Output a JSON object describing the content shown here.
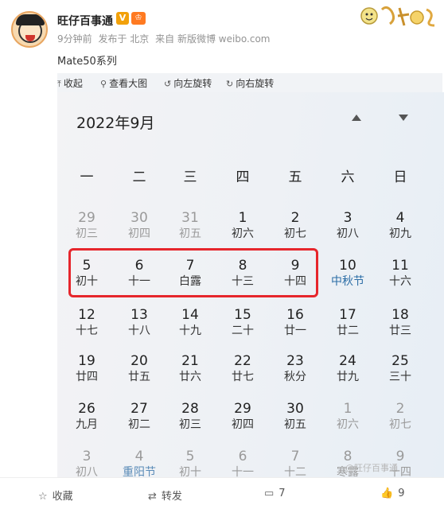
{
  "post": {
    "author": "旺仔百事通",
    "badge_v": "V",
    "badge_vip": "♔",
    "time": "9分钟前",
    "location": "发布于 北京",
    "source": "来自 新版微博 weibo.com",
    "text": "Mate50系列"
  },
  "toolbar": {
    "collapse": "收起",
    "view_large": "查看大图",
    "rotate_left": "向左旋转",
    "rotate_right": "向右旋转"
  },
  "calendar": {
    "title": "2022年9月",
    "weekdays": [
      "一",
      "二",
      "三",
      "四",
      "五",
      "六",
      "日"
    ],
    "rows": [
      [
        [
          "29",
          "初三",
          true,
          false
        ],
        [
          "30",
          "初四",
          true,
          false
        ],
        [
          "31",
          "初五",
          true,
          false
        ],
        [
          "1",
          "初六",
          false,
          false
        ],
        [
          "2",
          "初七",
          false,
          false
        ],
        [
          "3",
          "初八",
          false,
          false
        ],
        [
          "4",
          "初九",
          false,
          false
        ]
      ],
      [
        [
          "5",
          "初十",
          false,
          false
        ],
        [
          "6",
          "十一",
          false,
          false
        ],
        [
          "7",
          "白露",
          false,
          false
        ],
        [
          "8",
          "十三",
          false,
          false
        ],
        [
          "9",
          "十四",
          false,
          false
        ],
        [
          "10",
          "中秋节",
          false,
          true
        ],
        [
          "11",
          "十六",
          false,
          false
        ]
      ],
      [
        [
          "12",
          "十七",
          false,
          false
        ],
        [
          "13",
          "十八",
          false,
          false
        ],
        [
          "14",
          "十九",
          false,
          false
        ],
        [
          "15",
          "二十",
          false,
          false
        ],
        [
          "16",
          "廿一",
          false,
          false
        ],
        [
          "17",
          "廿二",
          false,
          false
        ],
        [
          "18",
          "廿三",
          false,
          false
        ]
      ],
      [
        [
          "19",
          "廿四",
          false,
          false
        ],
        [
          "20",
          "廿五",
          false,
          false
        ],
        [
          "21",
          "廿六",
          false,
          false
        ],
        [
          "22",
          "廿七",
          false,
          false
        ],
        [
          "23",
          "秋分",
          false,
          false
        ],
        [
          "24",
          "廿九",
          false,
          false
        ],
        [
          "25",
          "三十",
          false,
          false
        ]
      ],
      [
        [
          "26",
          "九月",
          false,
          false
        ],
        [
          "27",
          "初二",
          false,
          false
        ],
        [
          "28",
          "初三",
          false,
          false
        ],
        [
          "29",
          "初四",
          false,
          false
        ],
        [
          "30",
          "初五",
          false,
          false
        ],
        [
          "1",
          "初六",
          true,
          false
        ],
        [
          "2",
          "初七",
          true,
          false
        ]
      ],
      [
        [
          "3",
          "初八",
          true,
          false
        ],
        [
          "4",
          "重阳节",
          true,
          true
        ],
        [
          "5",
          "初十",
          true,
          false
        ],
        [
          "6",
          "十一",
          true,
          false
        ],
        [
          "7",
          "十二",
          true,
          false
        ],
        [
          "8",
          "寒露",
          true,
          false
        ],
        [
          "9",
          "十四",
          true,
          false
        ]
      ]
    ],
    "watermark": "@旺仔百事通"
  },
  "footer": {
    "favorite": "收藏",
    "repost": "转发",
    "comments": "7",
    "likes": "9"
  },
  "colors": {
    "highlight": "#e6262c",
    "festival": "#2c6ea6"
  }
}
